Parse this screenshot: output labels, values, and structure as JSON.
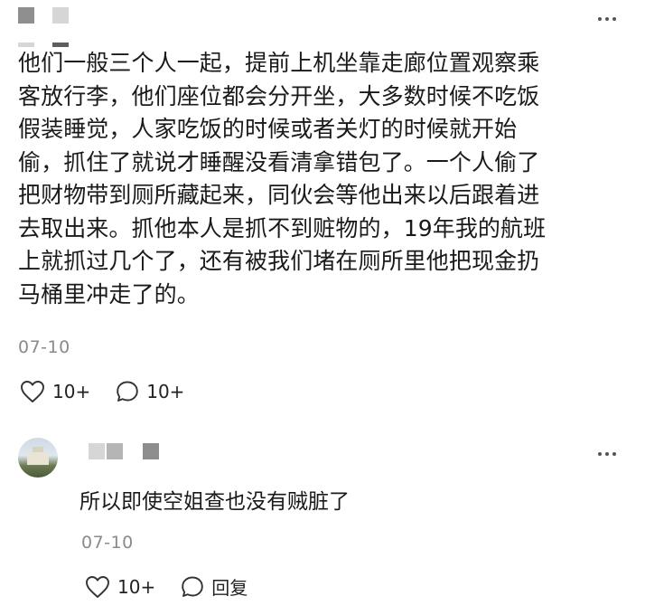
{
  "post": {
    "lines": [
      "他们一般三个人一起，提前上机坐靠走廊位置观察乘",
      "客放行李，他们座位都会分开坐，大多数时候不吃饭",
      "假装睡觉，人家吃饭的时候或者关灯的时候就开始",
      "偷，抓住了就说才睡醒没看清拿错包了。一个人偷了",
      "把财物带到厕所藏起来，同伙会等他出来以后跟着进",
      "去取出来。抓他本人是抓不到赃物的，19年我的航班",
      "上就抓过几个了，还有被我们堵在厕所里他把现金扔",
      "马桶里冲走了的。"
    ],
    "timestamp": "07-10",
    "like_count": "10+",
    "comment_count": "10+",
    "icons": {
      "like": "heart-outline-icon",
      "comment": "speech-bubble-icon",
      "more": "more-dots-icon"
    }
  },
  "reply": {
    "text": "所以即使空姐查也没有贼脏了",
    "timestamp": "07-10",
    "like_count": "10+",
    "reply_label": "回复",
    "icons": {
      "like": "heart-outline-icon",
      "reply": "speech-bubble-icon",
      "more": "more-dots-icon"
    }
  }
}
